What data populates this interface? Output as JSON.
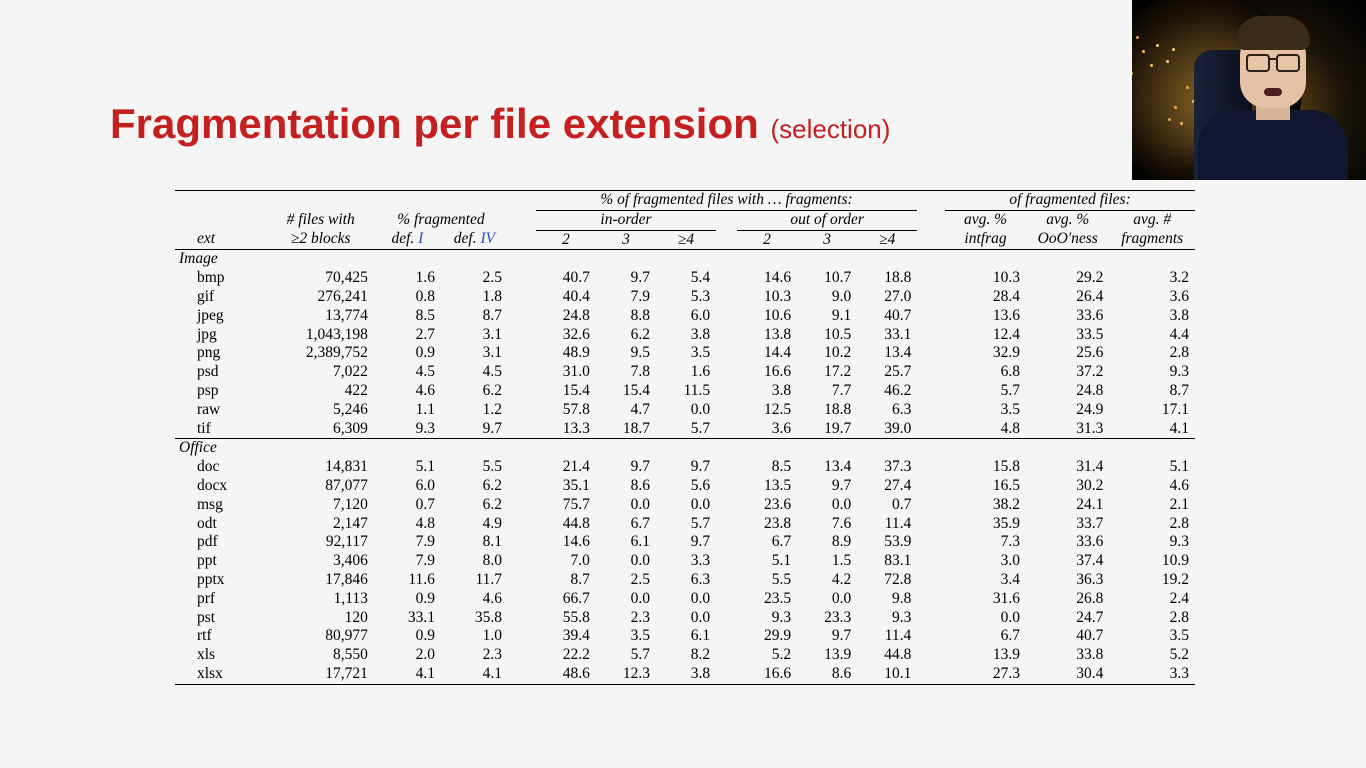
{
  "title": {
    "main": "Fragmentation per file extension",
    "sub": "(selection)"
  },
  "headers": {
    "super_fragpct": "% of fragmented files with … fragments:",
    "super_offrag": "of fragmented files:",
    "ext": "ext",
    "nfiles_l1": "# files with",
    "nfiles_l2": "≥2 blocks",
    "fragmented": "% fragmented",
    "def": "def.",
    "defI": "I",
    "defIV": "IV",
    "inorder": "in-order",
    "outorder": "out of order",
    "c2": "2",
    "c3": "3",
    "c4": "≥4",
    "avgpct": "avg. %",
    "intfrag": "intfrag",
    "ooo": "OoO'ness",
    "avgnum": "avg. #",
    "fragments": "fragments"
  },
  "groups": [
    {
      "name": "Image",
      "rows": [
        {
          "ext": "bmp",
          "n": "70,425",
          "d1": "1.6",
          "d4": "2.5",
          "i2": "40.7",
          "i3": "9.7",
          "i4": "5.4",
          "o2": "14.6",
          "o3": "10.7",
          "o4": "18.8",
          "intf": "10.3",
          "ooo": "29.2",
          "fr": "3.2"
        },
        {
          "ext": "gif",
          "n": "276,241",
          "d1": "0.8",
          "d4": "1.8",
          "i2": "40.4",
          "i3": "7.9",
          "i4": "5.3",
          "o2": "10.3",
          "o3": "9.0",
          "o4": "27.0",
          "intf": "28.4",
          "ooo": "26.4",
          "fr": "3.6"
        },
        {
          "ext": "jpeg",
          "n": "13,774",
          "d1": "8.5",
          "d4": "8.7",
          "i2": "24.8",
          "i3": "8.8",
          "i4": "6.0",
          "o2": "10.6",
          "o3": "9.1",
          "o4": "40.7",
          "intf": "13.6",
          "ooo": "33.6",
          "fr": "3.8"
        },
        {
          "ext": "jpg",
          "n": "1,043,198",
          "d1": "2.7",
          "d4": "3.1",
          "i2": "32.6",
          "i3": "6.2",
          "i4": "3.8",
          "o2": "13.8",
          "o3": "10.5",
          "o4": "33.1",
          "intf": "12.4",
          "ooo": "33.5",
          "fr": "4.4"
        },
        {
          "ext": "png",
          "n": "2,389,752",
          "d1": "0.9",
          "d4": "3.1",
          "i2": "48.9",
          "i3": "9.5",
          "i4": "3.5",
          "o2": "14.4",
          "o3": "10.2",
          "o4": "13.4",
          "intf": "32.9",
          "ooo": "25.6",
          "fr": "2.8"
        },
        {
          "ext": "psd",
          "n": "7,022",
          "d1": "4.5",
          "d4": "4.5",
          "i2": "31.0",
          "i3": "7.8",
          "i4": "1.6",
          "o2": "16.6",
          "o3": "17.2",
          "o4": "25.7",
          "intf": "6.8",
          "ooo": "37.2",
          "fr": "9.3"
        },
        {
          "ext": "psp",
          "n": "422",
          "d1": "4.6",
          "d4": "6.2",
          "i2": "15.4",
          "i3": "15.4",
          "i4": "11.5",
          "o2": "3.8",
          "o3": "7.7",
          "o4": "46.2",
          "intf": "5.7",
          "ooo": "24.8",
          "fr": "8.7"
        },
        {
          "ext": "raw",
          "n": "5,246",
          "d1": "1.1",
          "d4": "1.2",
          "i2": "57.8",
          "i3": "4.7",
          "i4": "0.0",
          "o2": "12.5",
          "o3": "18.8",
          "o4": "6.3",
          "intf": "3.5",
          "ooo": "24.9",
          "fr": "17.1"
        },
        {
          "ext": "tif",
          "n": "6,309",
          "d1": "9.3",
          "d4": "9.7",
          "i2": "13.3",
          "i3": "18.7",
          "i4": "5.7",
          "o2": "3.6",
          "o3": "19.7",
          "o4": "39.0",
          "intf": "4.8",
          "ooo": "31.3",
          "fr": "4.1"
        }
      ]
    },
    {
      "name": "Office",
      "rows": [
        {
          "ext": "doc",
          "n": "14,831",
          "d1": "5.1",
          "d4": "5.5",
          "i2": "21.4",
          "i3": "9.7",
          "i4": "9.7",
          "o2": "8.5",
          "o3": "13.4",
          "o4": "37.3",
          "intf": "15.8",
          "ooo": "31.4",
          "fr": "5.1"
        },
        {
          "ext": "docx",
          "n": "87,077",
          "d1": "6.0",
          "d4": "6.2",
          "i2": "35.1",
          "i3": "8.6",
          "i4": "5.6",
          "o2": "13.5",
          "o3": "9.7",
          "o4": "27.4",
          "intf": "16.5",
          "ooo": "30.2",
          "fr": "4.6"
        },
        {
          "ext": "msg",
          "n": "7,120",
          "d1": "0.7",
          "d4": "6.2",
          "i2": "75.7",
          "i3": "0.0",
          "i4": "0.0",
          "o2": "23.6",
          "o3": "0.0",
          "o4": "0.7",
          "intf": "38.2",
          "ooo": "24.1",
          "fr": "2.1"
        },
        {
          "ext": "odt",
          "n": "2,147",
          "d1": "4.8",
          "d4": "4.9",
          "i2": "44.8",
          "i3": "6.7",
          "i4": "5.7",
          "o2": "23.8",
          "o3": "7.6",
          "o4": "11.4",
          "intf": "35.9",
          "ooo": "33.7",
          "fr": "2.8"
        },
        {
          "ext": "pdf",
          "n": "92,117",
          "d1": "7.9",
          "d4": "8.1",
          "i2": "14.6",
          "i3": "6.1",
          "i4": "9.7",
          "o2": "6.7",
          "o3": "8.9",
          "o4": "53.9",
          "intf": "7.3",
          "ooo": "33.6",
          "fr": "9.3"
        },
        {
          "ext": "ppt",
          "n": "3,406",
          "d1": "7.9",
          "d4": "8.0",
          "i2": "7.0",
          "i3": "0.0",
          "i4": "3.3",
          "o2": "5.1",
          "o3": "1.5",
          "o4": "83.1",
          "intf": "3.0",
          "ooo": "37.4",
          "fr": "10.9"
        },
        {
          "ext": "pptx",
          "n": "17,846",
          "d1": "11.6",
          "d4": "11.7",
          "i2": "8.7",
          "i3": "2.5",
          "i4": "6.3",
          "o2": "5.5",
          "o3": "4.2",
          "o4": "72.8",
          "intf": "3.4",
          "ooo": "36.3",
          "fr": "19.2"
        },
        {
          "ext": "prf",
          "n": "1,113",
          "d1": "0.9",
          "d4": "4.6",
          "i2": "66.7",
          "i3": "0.0",
          "i4": "0.0",
          "o2": "23.5",
          "o3": "0.0",
          "o4": "9.8",
          "intf": "31.6",
          "ooo": "26.8",
          "fr": "2.4"
        },
        {
          "ext": "pst",
          "n": "120",
          "d1": "33.1",
          "d4": "35.8",
          "i2": "55.8",
          "i3": "2.3",
          "i4": "0.0",
          "o2": "9.3",
          "o3": "23.3",
          "o4": "9.3",
          "intf": "0.0",
          "ooo": "24.7",
          "fr": "2.8"
        },
        {
          "ext": "rtf",
          "n": "80,977",
          "d1": "0.9",
          "d4": "1.0",
          "i2": "39.4",
          "i3": "3.5",
          "i4": "6.1",
          "o2": "29.9",
          "o3": "9.7",
          "o4": "11.4",
          "intf": "6.7",
          "ooo": "40.7",
          "fr": "3.5"
        },
        {
          "ext": "xls",
          "n": "8,550",
          "d1": "2.0",
          "d4": "2.3",
          "i2": "22.2",
          "i3": "5.7",
          "i4": "8.2",
          "o2": "5.2",
          "o3": "13.9",
          "o4": "44.8",
          "intf": "13.9",
          "ooo": "33.8",
          "fr": "5.2"
        },
        {
          "ext": "xlsx",
          "n": "17,721",
          "d1": "4.1",
          "d4": "4.1",
          "i2": "48.6",
          "i3": "12.3",
          "i4": "3.8",
          "o2": "16.6",
          "o3": "8.6",
          "o4": "10.1",
          "intf": "27.3",
          "ooo": "30.4",
          "fr": "3.3"
        }
      ]
    }
  ]
}
